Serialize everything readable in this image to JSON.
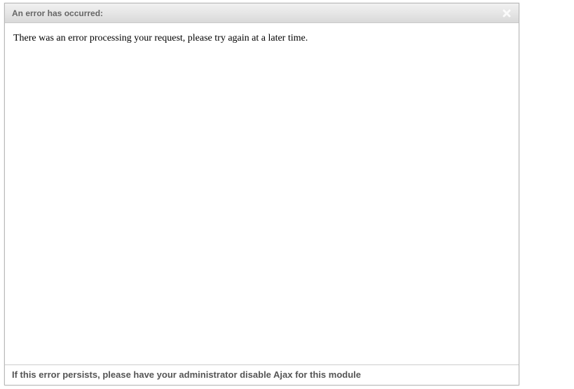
{
  "dialog": {
    "title": "An error has occurred:",
    "message": "There was an error processing your request, please try again at a later time.",
    "footer": "If this error persists, please have your administrator disable Ajax for this module"
  }
}
